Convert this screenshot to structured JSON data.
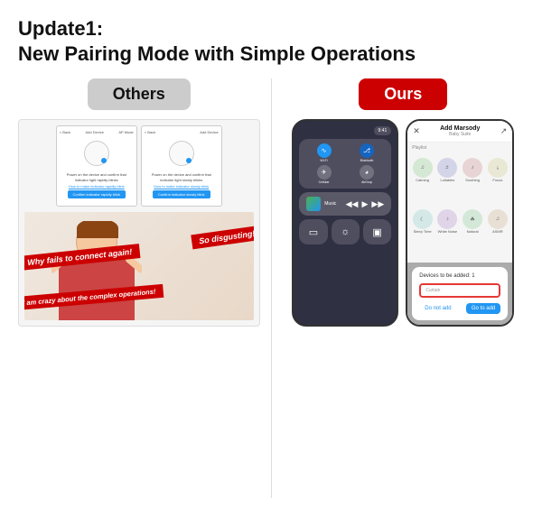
{
  "header": {
    "title_line1": "Update1:",
    "title_line2": "New Pairing Mode with Simple Operations"
  },
  "left": {
    "badge": "Others",
    "screen1": {
      "back": "< Back",
      "add": "Add Device",
      "ap_mode": "AP Mode",
      "text": "Power on the device and confirm that indicator light rapidly blinks",
      "link": "How to make indicator rapidly blink",
      "button": "Confirm indicator rapidly blink"
    },
    "screen2": {
      "back": "< Back",
      "add": "Add Device",
      "text": "Power on the device and confirm that indicator light slowly blinks",
      "link": "How to make indicator slowly blink",
      "button": "Confirm indicator slowly blink"
    },
    "banners": {
      "b1": "So disgusting!",
      "b2": "Why fails to connect again!",
      "b3": "I am crazy about the complex operations!"
    }
  },
  "right": {
    "badge": "Ours",
    "control_center": {
      "label": "Music"
    },
    "app_screen": {
      "nav_title": "Add Marsody",
      "nav_subtitle": "Baby Suite",
      "items": [
        {
          "label": "Calming"
        },
        {
          "label": "Lullabies"
        },
        {
          "label": "Soothing"
        },
        {
          "label": "Focus"
        },
        {
          "label": "Sleep Time"
        },
        {
          "label": "White Noise"
        },
        {
          "label": "Natural"
        },
        {
          "label": "ASMR"
        }
      ],
      "dialog": {
        "text": "Devices to be added: 1",
        "input_placeholder": "Curtain",
        "btn_cancel": "Do not add",
        "btn_confirm": "Go to add"
      }
    }
  }
}
